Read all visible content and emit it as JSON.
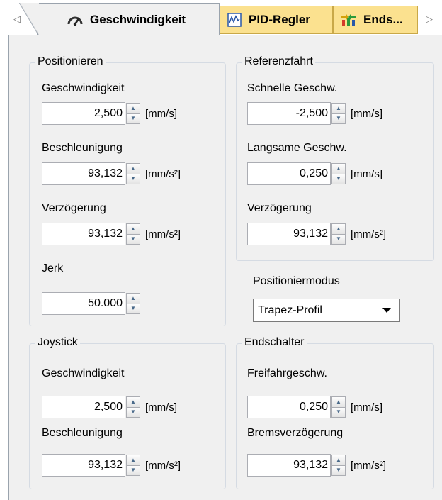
{
  "tabs": {
    "scroll_left_glyph": "◁",
    "scroll_right_glyph": "▷",
    "items": [
      {
        "label": "Geschwindigkeit",
        "icon": "speedometer-icon",
        "active": true
      },
      {
        "label": "PID-Regler",
        "icon": "pid-chart-icon",
        "active": false
      },
      {
        "label": "Ends...",
        "icon": "endstop-icon",
        "active": false
      }
    ]
  },
  "positionieren": {
    "title": "Positionieren",
    "geschwindigkeit": {
      "label": "Geschwindigkeit",
      "value": "2,500",
      "unit": "[mm/s]"
    },
    "beschleunigung": {
      "label": "Beschleunigung",
      "value": "93,132",
      "unit": "[mm/s²]"
    },
    "verzoegerung": {
      "label": "Verzögerung",
      "value": "93,132",
      "unit": "[mm/s²]"
    },
    "jerk": {
      "label": "Jerk",
      "value": "50.000"
    }
  },
  "referenzfahrt": {
    "title": "Referenzfahrt",
    "schnelle": {
      "label": "Schnelle Geschw.",
      "value": "-2,500",
      "unit": "[mm/s]"
    },
    "langsame": {
      "label": "Langsame Geschw.",
      "value": "0,250",
      "unit": "[mm/s]"
    },
    "verzoegerung": {
      "label": "Verzögerung",
      "value": "93,132",
      "unit": "[mm/s²]"
    }
  },
  "positioniermodus": {
    "label": "Positioniermodus",
    "selected": "Trapez-Profil"
  },
  "joystick": {
    "title": "Joystick",
    "geschwindigkeit": {
      "label": "Geschwindigkeit",
      "value": "2,500",
      "unit": "[mm/s]"
    },
    "beschleunigung": {
      "label": "Beschleunigung",
      "value": "93,132",
      "unit": "[mm/s²]"
    }
  },
  "endschalter": {
    "title": "Endschalter",
    "freifahr": {
      "label": "Freifahrgeschw.",
      "value": "0,250",
      "unit": "[mm/s]"
    },
    "brems": {
      "label": "Bremsverzögerung",
      "value": "93,132",
      "unit": "[mm/s²]"
    }
  },
  "spin_glyphs": {
    "up": "▲",
    "down": "▼"
  },
  "colors": {
    "tab_highlight": "#fbe18f",
    "panel_bg": "#f0f0f0",
    "group_border": "#d5dbe3"
  }
}
